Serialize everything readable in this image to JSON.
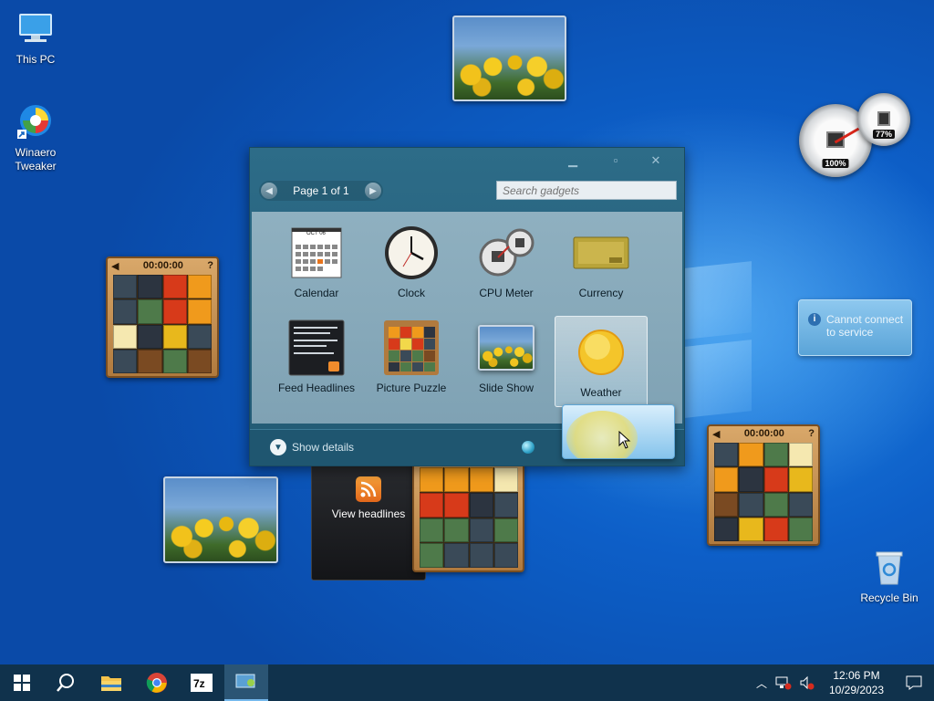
{
  "desktop": {
    "icons": [
      {
        "label": "This PC",
        "icon": "this-pc-icon"
      },
      {
        "label": "Winaero Tweaker",
        "icon": "winaero-tweaker-icon"
      },
      {
        "label": "Recycle Bin",
        "icon": "recycle-bin-icon"
      }
    ]
  },
  "gallery": {
    "pager_label": "Page 1 of 1",
    "search_placeholder": "Search gadgets",
    "gadgets": [
      {
        "label": "Calendar",
        "icon": "calendar-icon"
      },
      {
        "label": "Clock",
        "icon": "clock-icon"
      },
      {
        "label": "CPU Meter",
        "icon": "cpu-meter-icon"
      },
      {
        "label": "Currency",
        "icon": "currency-icon"
      },
      {
        "label": "Feed Headlines",
        "icon": "feed-headlines-icon"
      },
      {
        "label": "Picture Puzzle",
        "icon": "picture-puzzle-icon"
      },
      {
        "label": "Slide Show",
        "icon": "slide-show-icon"
      },
      {
        "label": "Weather",
        "icon": "weather-icon",
        "selected": true
      }
    ],
    "calendar_month": "OCT 06",
    "show_details": "Show details"
  },
  "puzzles": {
    "timer": "00:00:00"
  },
  "feed_gadget": {
    "label": "View headlines"
  },
  "weather_gadget": {
    "message": "Cannot connect to service"
  },
  "cpu_meter": {
    "cpu_pct": "100%",
    "mem_pct": "77%"
  },
  "taskbar": {
    "apps": [
      "start-button",
      "search-icon",
      "file-explorer-icon",
      "chrome-icon",
      "7zip-icon",
      "gadgets-icon"
    ],
    "time": "12:06 PM",
    "date": "10/29/2023"
  },
  "colors": {
    "desktop_blue": "#0d5fc8",
    "gallery_frame": "#2d6c88",
    "taskbar": "#10324c"
  }
}
